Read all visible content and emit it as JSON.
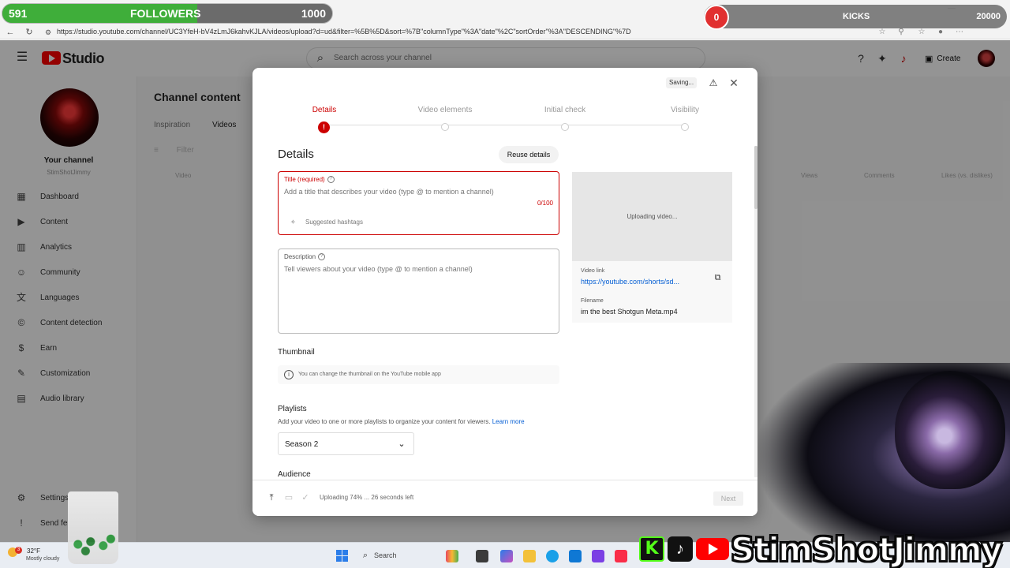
{
  "overlay": {
    "followers": {
      "current": "591",
      "label": "FOLLOWERS",
      "goal": "1000",
      "progress": 0.591
    },
    "kicks": {
      "current": "0",
      "label": "KICKS",
      "goal": "20000"
    },
    "brand": {
      "name": "StimShotJimmy"
    }
  },
  "browser": {
    "url": "https://studio.youtube.com/channel/UC3YfeH-bV4zLmJ6kahvKJLA/videos/upload?d=ud&filter=%5B%5D&sort=%7B\"columnType\"%3A\"date\"%2C\"sortOrder\"%3A\"DESCENDING\"%7D"
  },
  "header": {
    "logo_text": "Studio",
    "search_placeholder": "Search across your channel",
    "create_label": "Create"
  },
  "sidebar": {
    "your_channel": "Your channel",
    "handle": "StimShotJimmy",
    "items": [
      {
        "label": "Dashboard",
        "icon": "dashboard-icon"
      },
      {
        "label": "Content",
        "icon": "content-icon"
      },
      {
        "label": "Analytics",
        "icon": "analytics-icon"
      },
      {
        "label": "Community",
        "icon": "community-icon"
      },
      {
        "label": "Languages",
        "icon": "languages-icon"
      },
      {
        "label": "Content detection",
        "icon": "copyright-icon"
      },
      {
        "label": "Earn",
        "icon": "earn-icon"
      },
      {
        "label": "Customization",
        "icon": "customization-icon"
      },
      {
        "label": "Audio library",
        "icon": "audio-library-icon"
      }
    ],
    "settings": "Settings",
    "send_feedback": "Send fe"
  },
  "main": {
    "title": "Channel content",
    "tabs": [
      "Inspiration",
      "Videos"
    ],
    "filter": "Filter",
    "columns": [
      "Video",
      "Views",
      "Comments",
      "Likes (vs. dislikes)"
    ]
  },
  "modal": {
    "saving": "Saving...",
    "steps": [
      "Details",
      "Video elements",
      "Initial check",
      "Visibility"
    ],
    "active_step": 0,
    "heading": "Details",
    "reuse_label": "Reuse details",
    "title_field": {
      "label": "Title (required)",
      "placeholder": "Add a title that describes your video (type @ to mention a channel)",
      "count": "0/100",
      "hashtags": "Suggested hashtags"
    },
    "description_field": {
      "label": "Description",
      "placeholder": "Tell viewers about your video (type @ to mention a channel)"
    },
    "preview": {
      "status": "Uploading video...",
      "link_label": "Video link",
      "link": "https://youtube.com/shorts/sd...",
      "filename_label": "Filename",
      "filename": "im the best Shotgun Meta.mp4"
    },
    "thumbnail": {
      "heading": "Thumbnail",
      "info": "You can change the thumbnail on the YouTube mobile app"
    },
    "playlists": {
      "heading": "Playlists",
      "desc": "Add your video to one or more playlists to organize your content for viewers.",
      "learn_more": "Learn more",
      "selected": "Season 2"
    },
    "audience_heading": "Audience",
    "footer": {
      "status": "Uploading 74% ... 26 seconds left",
      "upload_progress": 0.74,
      "next": "Next"
    }
  },
  "taskbar": {
    "temp": "32°F",
    "weather": "Mostly cloudy",
    "weather_badge": "3",
    "search": "Search"
  }
}
